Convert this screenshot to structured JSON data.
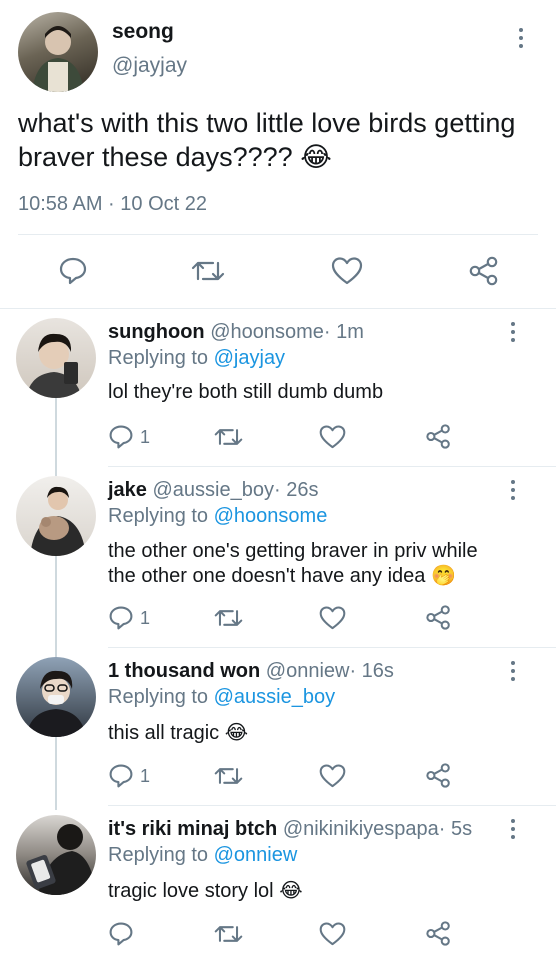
{
  "main_tweet": {
    "display_name": "seong",
    "handle": "@jayjay",
    "text": "what's with this two little love birds getting braver these days????",
    "emoji": "😂",
    "timestamp": "10:58 AM · 10 Oct 22"
  },
  "replies": [
    {
      "display_name": "sunghoon",
      "handle": "@hoonsome",
      "time": "· 1m",
      "replying_label": "Replying to",
      "replying_to": "@jayjay",
      "text": "lol they're both still dumb dumb",
      "reply_count": "1"
    },
    {
      "display_name": "jake",
      "handle": "@aussie_boy",
      "time": "· 26s",
      "replying_label": "Replying to",
      "replying_to": "@hoonsome",
      "text_line1": "the other one's getting braver in priv while",
      "text_line2": "the other one doesn't have any idea",
      "emoji": "🤭",
      "reply_count": "1"
    },
    {
      "display_name": "1 thousand won",
      "handle": "@onniew",
      "time": "· 16s",
      "replying_label": "Replying to",
      "replying_to": "@aussie_boy",
      "text": "this all tragic",
      "emoji": "😂",
      "reply_count": "1"
    },
    {
      "display_name": "it's riki minaj btch",
      "handle": "@nikinikiyespapa",
      "time": "· 5s",
      "replying_label": "Replying to",
      "replying_to": "@onniew",
      "text": "tragic love story lol",
      "emoji": "😂",
      "reply_count": ""
    }
  ],
  "icons": {
    "reply": "speech-bubble-icon",
    "retweet": "retweet-icon",
    "like": "heart-icon",
    "share": "share-icon",
    "more": "vertical-dots-icon"
  },
  "colors": {
    "link": "#1b95e0",
    "muted": "#657786",
    "text": "#14171a",
    "divider": "#e6ecf0",
    "thread_line": "#cfd9de"
  }
}
